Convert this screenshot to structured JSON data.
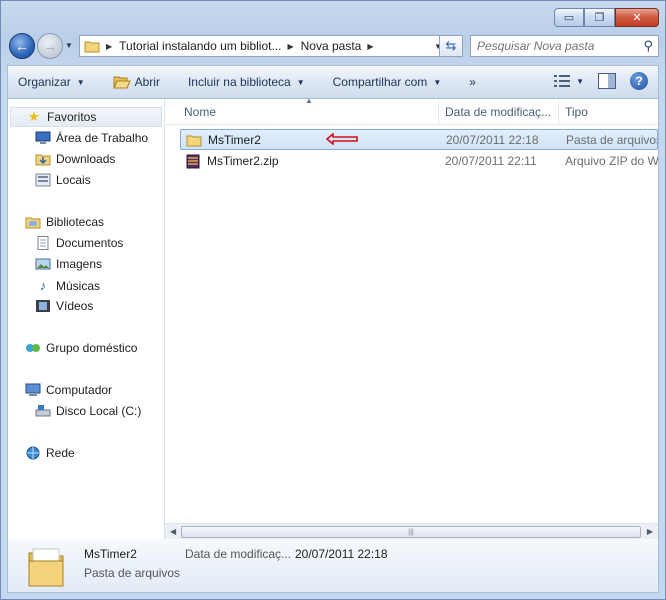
{
  "window": {
    "minimize": "▭",
    "maximize": "❐",
    "close": "✕"
  },
  "nav": {
    "back_icon": "←",
    "forward_icon": "→",
    "address_crumbs": [
      "Tutorial instalando um bibliot...",
      "Nova pasta"
    ],
    "search_placeholder": "Pesquisar Nova pasta"
  },
  "toolbar": {
    "organizar": "Organizar",
    "abrir": "Abrir",
    "incluir": "Incluir na biblioteca",
    "compartilhar": "Compartilhar com",
    "more": "»"
  },
  "sidebar": {
    "favoritos": "Favoritos",
    "area_trabalho": "Área de Trabalho",
    "downloads": "Downloads",
    "locais": "Locais",
    "bibliotecas": "Bibliotecas",
    "documentos": "Documentos",
    "imagens": "Imagens",
    "musicas": "Músicas",
    "videos": "Vídeos",
    "grupo": "Grupo doméstico",
    "computador": "Computador",
    "disco": "Disco Local (C:)",
    "rede": "Rede"
  },
  "columns": {
    "nome": "Nome",
    "data": "Data de modificaç...",
    "tipo": "Tipo"
  },
  "files": [
    {
      "name": "MsTimer2",
      "date": "20/07/2011 22:18",
      "type": "Pasta de arquivos"
    },
    {
      "name": "MsTimer2.zip",
      "date": "20/07/2011 22:11",
      "type": "Arquivo ZIP do Wi"
    }
  ],
  "details": {
    "name": "MsTimer2",
    "type": "Pasta de arquivos",
    "label": "Data de modificaç...",
    "value": "20/07/2011 22:18"
  }
}
